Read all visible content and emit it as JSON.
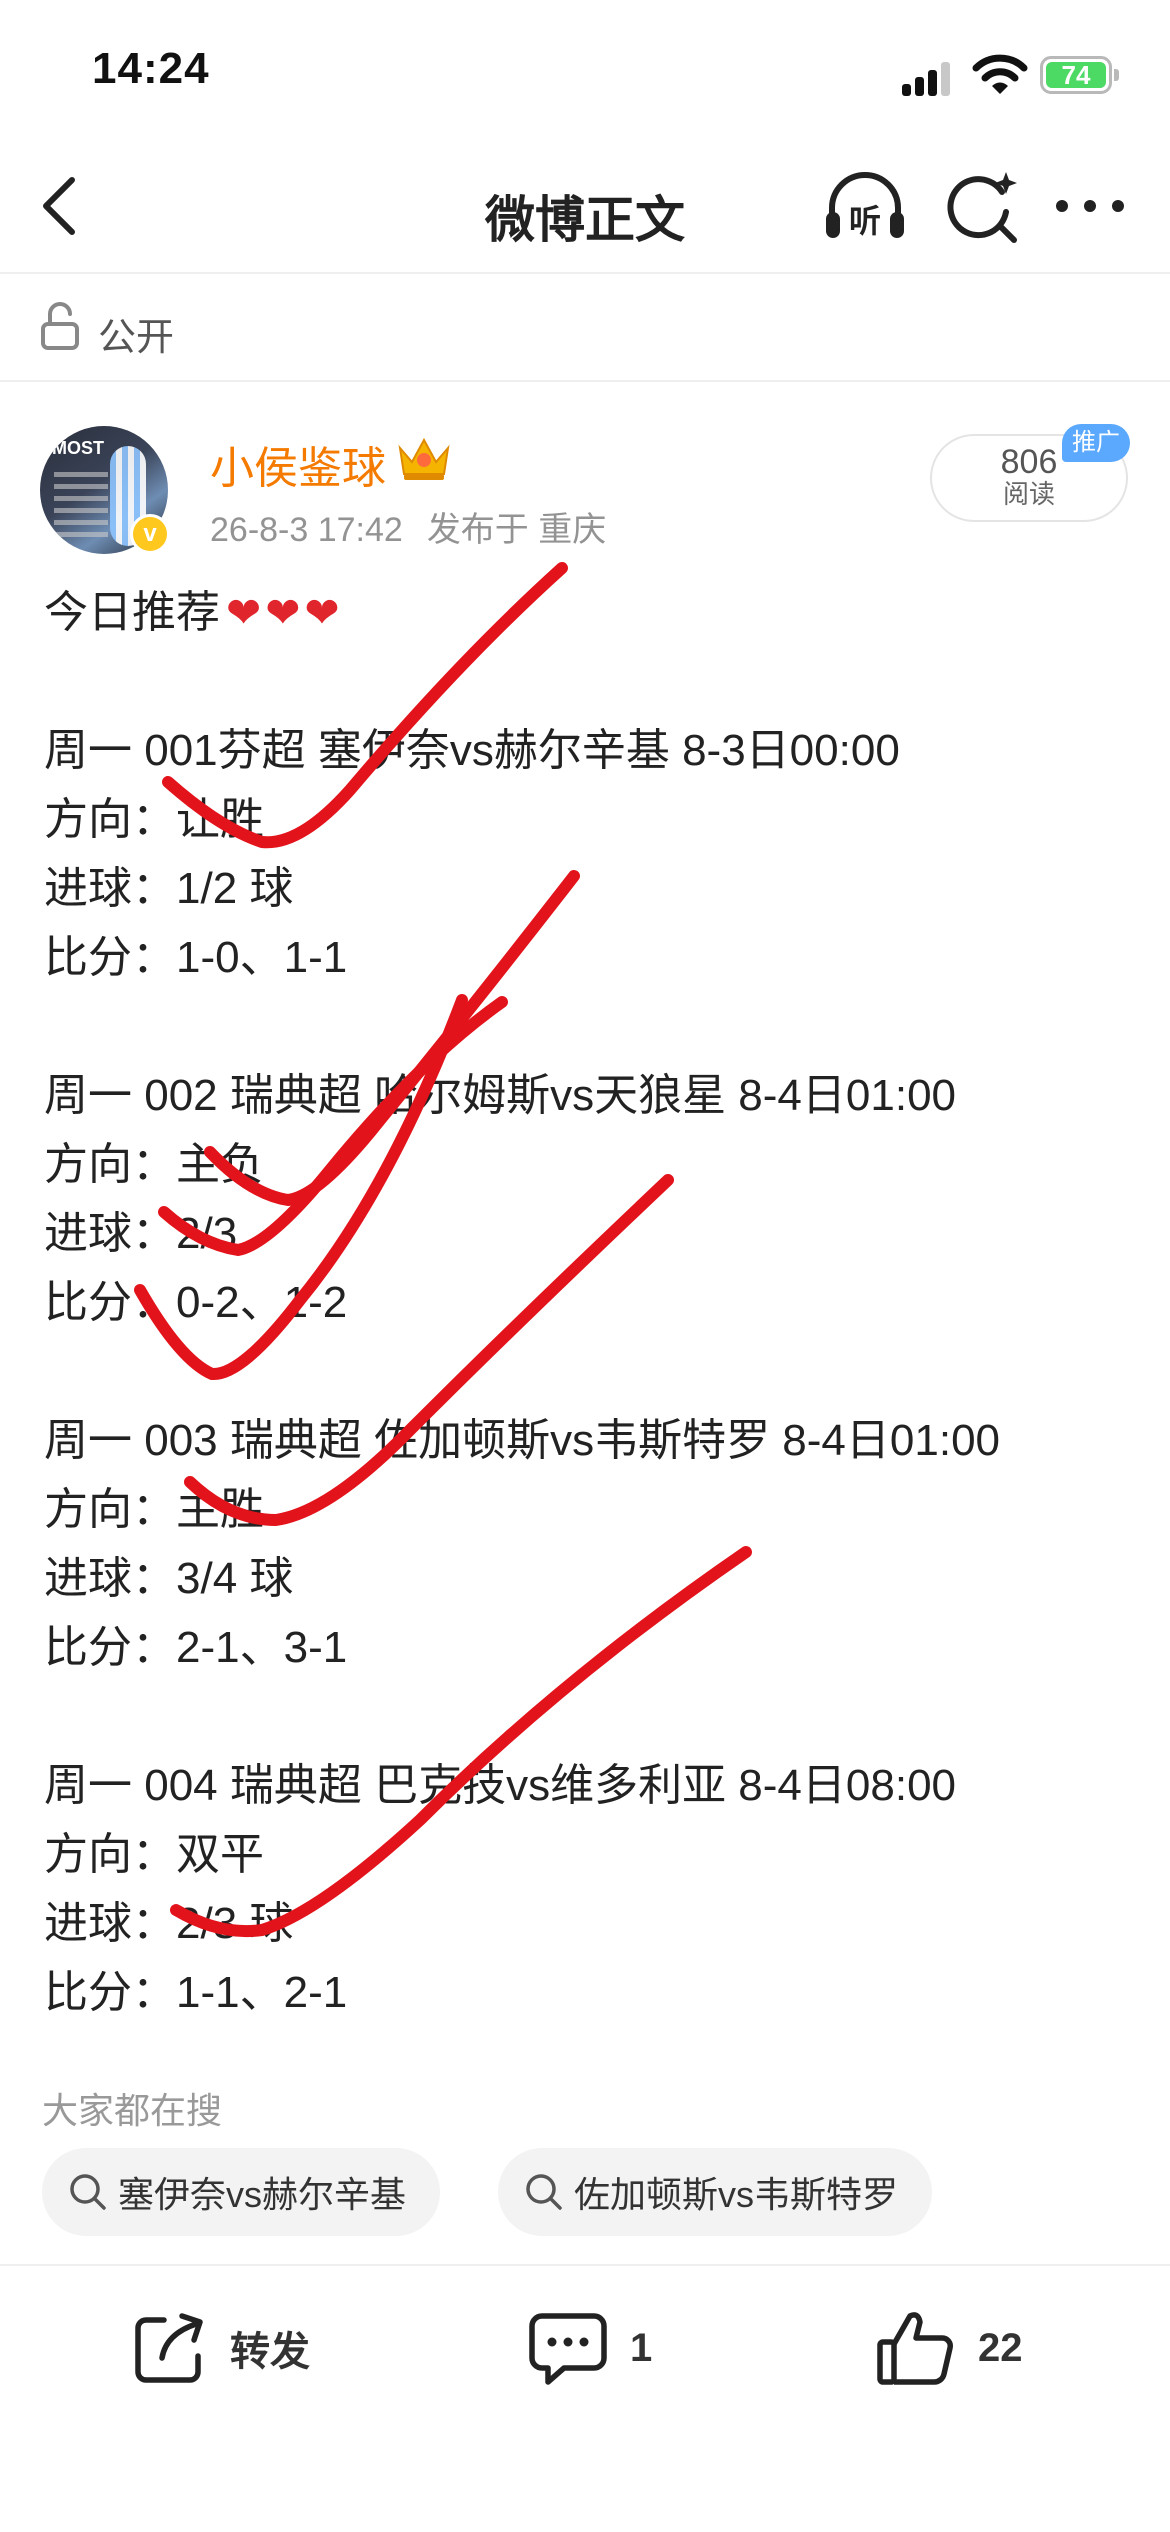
{
  "status_bar": {
    "time": "14:24",
    "battery": "74"
  },
  "nav": {
    "title": "微博正文",
    "listen_label": "听"
  },
  "visibility": {
    "label": "公开"
  },
  "author": {
    "name": "小侯鉴球",
    "avatar_text": "MOST",
    "verified_mark": "v",
    "timestamp": "26-8-3 17:42",
    "location": "发布于 重庆"
  },
  "read_box": {
    "count": "806",
    "label": "阅读",
    "promo": "推广"
  },
  "post": {
    "intro": "今日推荐",
    "hearts": "❤❤❤",
    "lines": [
      "周一 001芬超 塞伊奈vs赫尔辛基  8-3日00:00",
      "方向：让胜",
      "进球：1/2 球",
      "比分：1-0、1-1",
      "",
      "周一 002 瑞典超 哈尔姆斯vs天狼星 8-4日01:00",
      "方向：主负",
      "进球：2/3",
      "比分：0-2、1-2",
      "",
      "周一 003 瑞典超 佐加顿斯vs韦斯特罗 8-4日01:00",
      "方向：主胜",
      "进球：3/4 球",
      "比分：2-1、3-1",
      "",
      "周一 004 瑞典超 巴克技vs维多利亚 8-4日08:00",
      "方向：双平",
      "进球：2/3 球",
      "比分：1-1、2-1"
    ]
  },
  "hot_search": {
    "title": "大家都在搜",
    "chips": [
      "塞伊奈vs赫尔辛基",
      "佐加顿斯vs韦斯特罗"
    ]
  },
  "actions": {
    "repost": "转发",
    "comments": "1",
    "likes": "22"
  },
  "colors": {
    "author_name": "#f47a00",
    "checkmark": "#e3131b",
    "battery": "#4cd964",
    "promo": "#5aa9ff"
  }
}
